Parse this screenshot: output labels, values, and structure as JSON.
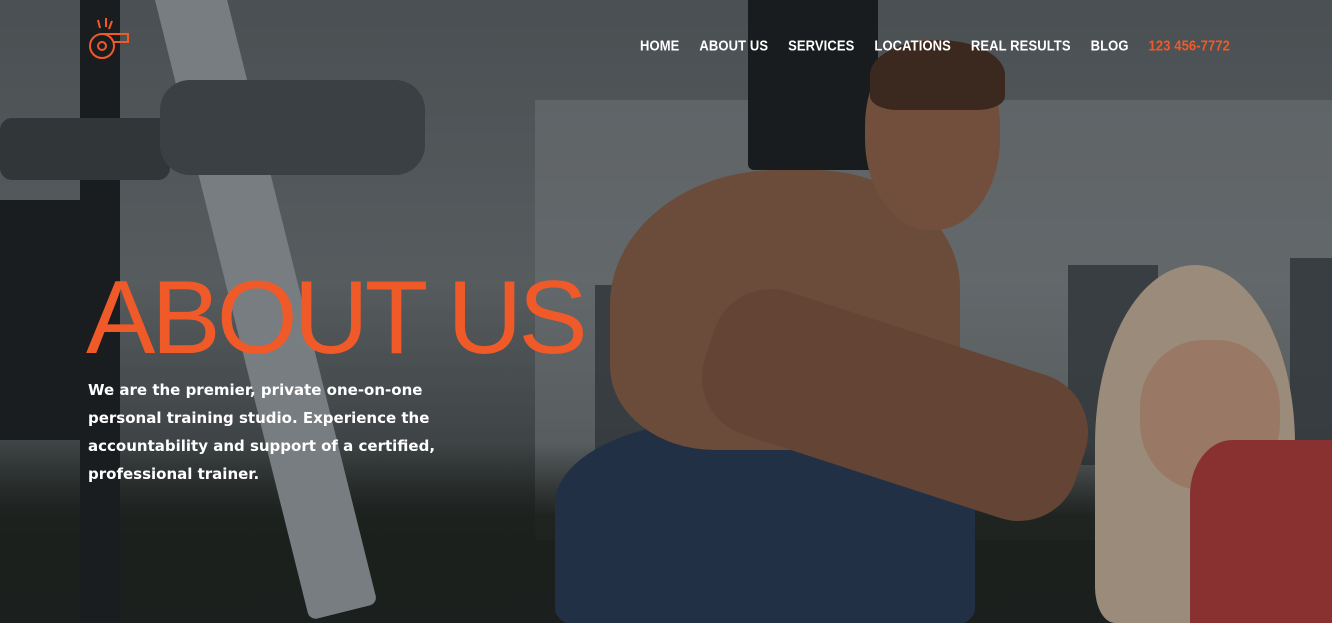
{
  "brand": {
    "logo_icon": "trainer-whistle-logo-icon",
    "accent_color": "#f05a28"
  },
  "nav": {
    "items": [
      {
        "label": "HOME"
      },
      {
        "label": "ABOUT US"
      },
      {
        "label": "SERVICES"
      },
      {
        "label": "LOCATIONS"
      },
      {
        "label": "REAL RESULTS"
      },
      {
        "label": "BLOG"
      }
    ],
    "phone": "123 456-7772"
  },
  "hero": {
    "title": "ABOUT US",
    "description": "We are the premier, private one-on-one personal training studio. Experience the accountability and support of a certified, professional trainer."
  }
}
